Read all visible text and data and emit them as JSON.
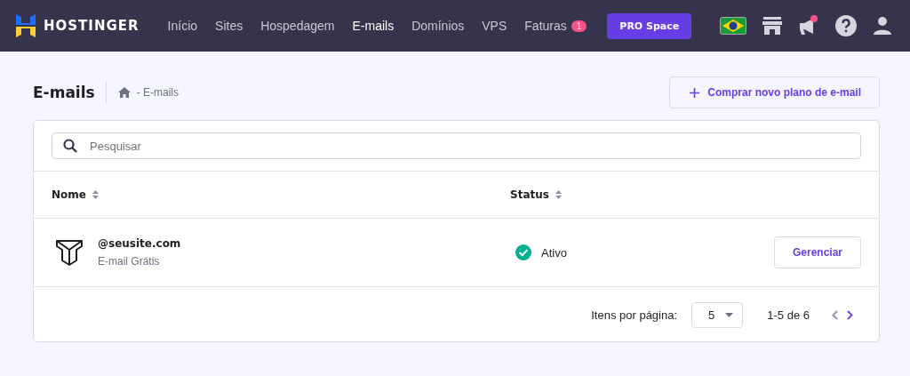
{
  "brand": {
    "name": "HOSTINGER"
  },
  "nav": [
    {
      "label": "Início",
      "selected": false
    },
    {
      "label": "Sites",
      "selected": false
    },
    {
      "label": "Hospedagem",
      "selected": false
    },
    {
      "label": "E-mails",
      "selected": true
    },
    {
      "label": "Domínios",
      "selected": false
    },
    {
      "label": "VPS",
      "selected": false
    },
    {
      "label": "Faturas",
      "selected": false,
      "badge": "1"
    }
  ],
  "pro_button": "PRO Space",
  "notifications": {
    "unread": true
  },
  "page": {
    "title": "E-mails",
    "breadcrumb": "- E-mails",
    "buy_button": "Comprar novo plano de e-mail"
  },
  "search": {
    "placeholder": "Pesquisar"
  },
  "table": {
    "columns": [
      "Nome",
      "Status"
    ],
    "rows": [
      {
        "domain": "@seusite.com",
        "plan": "E-mail Grátis",
        "status": "Ativo",
        "status_ok": true,
        "action": "Gerenciar"
      }
    ]
  },
  "pagination": {
    "label": "Itens por página:",
    "per_page": "5",
    "range": "1-5 de 6",
    "prev_disabled": true,
    "next_disabled": false
  }
}
